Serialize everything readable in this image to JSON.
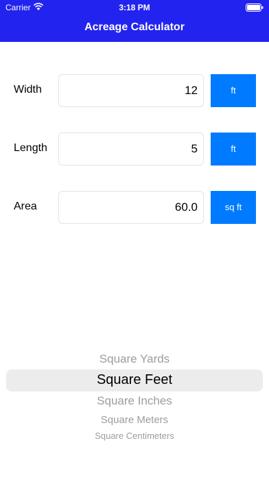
{
  "status_bar": {
    "carrier": "Carrier",
    "time": "3:18 PM"
  },
  "nav": {
    "title": "Acreage Calculator"
  },
  "form": {
    "width": {
      "label": "Width",
      "value": "12",
      "unit": "ft"
    },
    "length": {
      "label": "Length",
      "value": "5",
      "unit": "ft"
    },
    "area": {
      "label": "Area",
      "value": "60.0",
      "unit": "sq ft"
    }
  },
  "picker": {
    "options": [
      "Square Yards",
      "Square Feet",
      "Square Inches",
      "Square Meters",
      "Square Centimeters"
    ],
    "selected": "Square Feet"
  },
  "colors": {
    "header": "#2323f0",
    "button": "#007aff"
  }
}
